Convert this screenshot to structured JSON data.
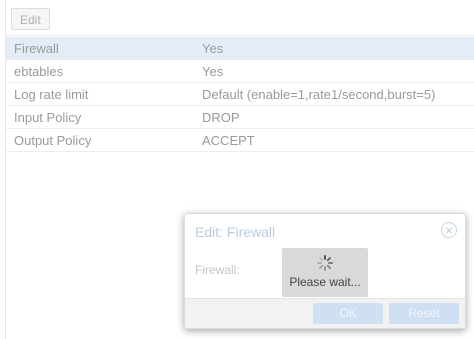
{
  "toolbar": {
    "edit_label": "Edit"
  },
  "rows": [
    {
      "key": "Firewall",
      "value": "Yes",
      "selected": true
    },
    {
      "key": "ebtables",
      "value": "Yes",
      "selected": false
    },
    {
      "key": "Log rate limit",
      "value": "Default (enable=1,rate1/second,burst=5)",
      "selected": false
    },
    {
      "key": "Input Policy",
      "value": "DROP",
      "selected": false
    },
    {
      "key": "Output Policy",
      "value": "ACCEPT",
      "selected": false
    }
  ],
  "dialog": {
    "title": "Edit: Firewall",
    "field_label": "Firewall:",
    "loading_text": "Please wait...",
    "ok_label": "OK",
    "reset_label": "Reset"
  },
  "colors": {
    "selected_row": "#e4edf7",
    "button_disabled": "#cfe0f2",
    "title_text": "#b7cce0"
  },
  "icons": [
    "close-icon",
    "spinner-icon"
  ]
}
